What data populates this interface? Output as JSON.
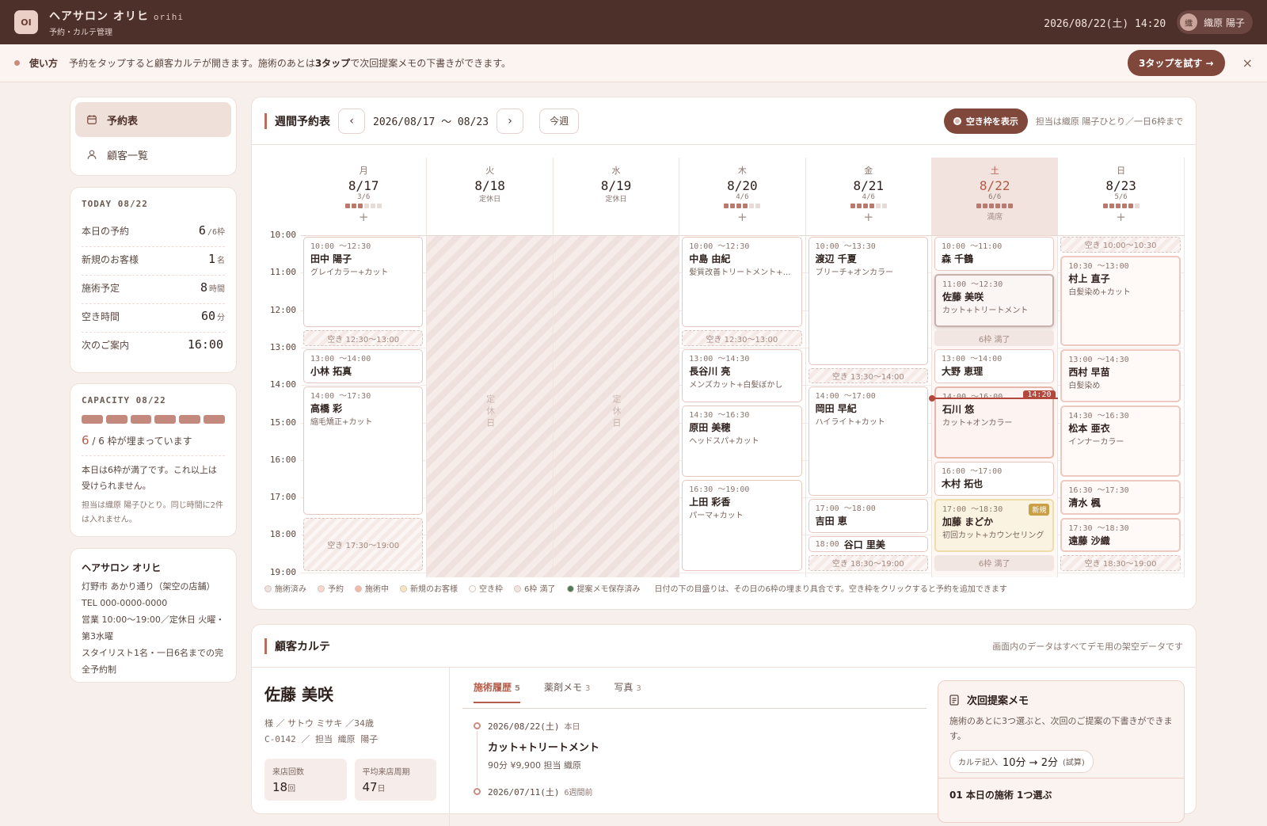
{
  "app": {
    "logo": "OI",
    "name": "ヘアサロン オリヒ",
    "name_en": "orihi",
    "sub": "予約・カルテ管理",
    "datetime": "2026/08/22(土) 14:20",
    "user_avatar": "織",
    "user_name": "織原 陽子"
  },
  "hint": {
    "title": "使い方",
    "text_a": "予約をタップすると顧客カルテが開きます。施術のあとは",
    "text_b": "3タップ",
    "text_c": "で次回提案メモの下書きができます。",
    "button": "3タップを試す →",
    "close": "×"
  },
  "nav": [
    {
      "label": "予約表",
      "icon": "calendar-icon"
    },
    {
      "label": "顧客一覧",
      "icon": "person-icon"
    }
  ],
  "today": {
    "title": "TODAY 08/22",
    "rows": [
      {
        "label": "本日の予約",
        "value": "6",
        "unit": "/6枠"
      },
      {
        "label": "新規のお客様",
        "value": "1",
        "unit": "名"
      },
      {
        "label": "施術予定",
        "value": "8",
        "unit": "時間"
      },
      {
        "label": "空き時間",
        "value": "60",
        "unit": "分"
      },
      {
        "label": "次のご案内",
        "value": "16:00",
        "unit": ""
      }
    ]
  },
  "capacity": {
    "title": "CAPACITY 08/22",
    "filled": 6,
    "total": 6,
    "count": "6",
    "count_text": "/ 6 枠が埋まっています",
    "msg": "本日は6枠が満了です。これ以上は受けられません。",
    "msg2": "担当は織原 陽子ひとり。同じ時間に2件は入れません。"
  },
  "shop": {
    "name": "ヘアサロン オリヒ",
    "lines": [
      "灯野市 あかり通り（架空の店舗）",
      "TEL 000-0000-0000",
      "営業 10:00〜19:00／定休日 火曜・第3水曜",
      "スタイリスト1名・一日6名までの完全予約制"
    ]
  },
  "schedule": {
    "title": "週間予約表",
    "range": "2026/08/17 〜 08/23",
    "this_week": "今週",
    "toggle": "空き枠を表示",
    "note": "担当は織原 陽子ひとり／一日6枠まで",
    "hours": [
      "10:00",
      "11:00",
      "12:00",
      "13:00",
      "14:00",
      "15:00",
      "16:00",
      "17:00",
      "18:00",
      "19:00"
    ],
    "closed_label": "定休日",
    "now": {
      "label": "14:20",
      "hour": 14.333
    },
    "days": [
      {
        "wd": "月",
        "date": "8/17",
        "cap": "3/6",
        "filled": 3,
        "closed": false,
        "plus": "+",
        "events": [
          {
            "kind": "plan",
            "s": 10,
            "e": 12.5,
            "tm": "10:00 〜12:30",
            "nm": "田中 陽子",
            "mn": "グレイカラー+カット"
          },
          {
            "kind": "free",
            "s": 12.5,
            "e": 13,
            "label": "空き 12:30〜13:00"
          },
          {
            "kind": "plan",
            "s": 13,
            "e": 14,
            "tm": "13:00 〜14:00",
            "nm": "小林 拓真",
            "mn": ""
          },
          {
            "kind": "plan",
            "s": 14,
            "e": 17.5,
            "tm": "14:00 〜17:30",
            "nm": "高橋 彩",
            "mn": "縮毛矯正+カット"
          },
          {
            "kind": "free",
            "s": 17.5,
            "e": 19,
            "label": "空き 17:30〜19:00"
          }
        ]
      },
      {
        "wd": "火",
        "date": "8/18",
        "cap": "定休日",
        "filled": -1,
        "closed": true,
        "plus": "",
        "events": []
      },
      {
        "wd": "水",
        "date": "8/19",
        "cap": "定休日",
        "filled": -1,
        "closed": true,
        "plus": "",
        "events": []
      },
      {
        "wd": "木",
        "date": "8/20",
        "cap": "4/6",
        "filled": 4,
        "closed": false,
        "plus": "+",
        "events": [
          {
            "kind": "plan",
            "s": 10,
            "e": 12.5,
            "tm": "10:00 〜12:30",
            "nm": "中島 由紀",
            "mn": "髪質改善トリートメント+カット"
          },
          {
            "kind": "free",
            "s": 12.5,
            "e": 13,
            "label": "空き 12:30〜13:00"
          },
          {
            "kind": "plan",
            "s": 13,
            "e": 14.5,
            "tm": "13:00 〜14:30",
            "nm": "長谷川 亮",
            "mn": "メンズカット+白髪ぼかし"
          },
          {
            "kind": "plan",
            "s": 14.5,
            "e": 16.5,
            "tm": "14:30 〜16:30",
            "nm": "原田 美穂",
            "mn": "ヘッドスパ+カット"
          },
          {
            "kind": "plan",
            "s": 16.5,
            "e": 19,
            "tm": "16:30 〜19:00",
            "nm": "上田 彩香",
            "mn": "パーマ+カット"
          }
        ]
      },
      {
        "wd": "金",
        "date": "8/21",
        "cap": "4/6",
        "filled": 4,
        "closed": false,
        "plus": "+",
        "events": [
          {
            "kind": "plan",
            "s": 10,
            "e": 13.5,
            "tm": "10:00 〜13:30",
            "nm": "渡辺 千夏",
            "mn": "ブリーチ+オンカラー"
          },
          {
            "kind": "free",
            "s": 13.5,
            "e": 14,
            "label": "空き 13:30〜14:00"
          },
          {
            "kind": "plan",
            "s": 14,
            "e": 17,
            "tm": "14:00 〜17:00",
            "nm": "岡田 早紀",
            "mn": "ハイライト+カット"
          },
          {
            "kind": "plan",
            "s": 17,
            "e": 18,
            "tm": "17:00 〜18:00",
            "nm": "吉田 恵",
            "mn": ""
          },
          {
            "kind": "short",
            "s": 18,
            "e": 18.5,
            "tm": "18:00",
            "nm": "谷口 里美",
            "mn": ""
          },
          {
            "kind": "free",
            "s": 18.5,
            "e": 19,
            "label": "空き 18:30〜19:00"
          }
        ]
      },
      {
        "wd": "土",
        "date": "8/22",
        "cap": "6/6",
        "filled": 6,
        "closed": false,
        "plus": "満席",
        "today": true,
        "events": [
          {
            "kind": "plan",
            "s": 10,
            "e": 11,
            "tm": "10:00 〜11:00",
            "nm": "森 千鶴",
            "mn": ""
          },
          {
            "kind": "sel",
            "s": 11,
            "e": 12.5,
            "tm": "11:00 〜12:30",
            "nm": "佐藤 美咲",
            "mn": "カット+トリートメント"
          },
          {
            "kind": "full",
            "s": 12.5,
            "e": 13,
            "label": "6枠 満了"
          },
          {
            "kind": "plan",
            "s": 13,
            "e": 14,
            "tm": "13:00 〜14:00",
            "nm": "大野 恵理",
            "mn": ""
          },
          {
            "kind": "inprog",
            "s": 14,
            "e": 16,
            "tm": "14:00 〜16:00",
            "nm": "石川 悠",
            "mn": "カット+オンカラー"
          },
          {
            "kind": "plan",
            "s": 16,
            "e": 17,
            "tm": "16:00 〜17:00",
            "nm": "木村 拓也",
            "mn": ""
          },
          {
            "kind": "newc",
            "s": 17,
            "e": 18.5,
            "tm": "17:00 〜18:30",
            "nm": "加藤 まどか",
            "mn": "初回カット+カウンセリング",
            "badge": "新規"
          },
          {
            "kind": "full",
            "s": 18.5,
            "e": 19,
            "label": "6枠 満了"
          }
        ]
      },
      {
        "wd": "日",
        "date": "8/23",
        "cap": "5/6",
        "filled": 5,
        "closed": false,
        "plus": "+",
        "events": [
          {
            "kind": "free",
            "s": 10,
            "e": 10.5,
            "label": "空き 10:00〜10:30"
          },
          {
            "kind": "pink",
            "s": 10.5,
            "e": 13,
            "tm": "10:30 〜13:00",
            "nm": "村上 直子",
            "mn": "白髪染め+カット"
          },
          {
            "kind": "pink",
            "s": 13,
            "e": 14.5,
            "tm": "13:00 〜14:30",
            "nm": "西村 早苗",
            "mn": "白髪染め"
          },
          {
            "kind": "pink",
            "s": 14.5,
            "e": 16.5,
            "tm": "14:30 〜16:30",
            "nm": "松本 亜衣",
            "mn": "インナーカラー"
          },
          {
            "kind": "pink",
            "s": 16.5,
            "e": 17.5,
            "tm": "16:30 〜17:30",
            "nm": "清水 楓",
            "mn": ""
          },
          {
            "kind": "pink",
            "s": 17.5,
            "e": 18.5,
            "tm": "17:30 〜18:30",
            "nm": "遠藤 沙織",
            "mn": ""
          },
          {
            "kind": "free",
            "s": 18.5,
            "e": 19,
            "label": "空き 18:30〜19:00"
          }
        ]
      }
    ],
    "legend": [
      {
        "label": "施術済み",
        "color": "#ece2de"
      },
      {
        "label": "予約",
        "color": "#f6d9d1"
      },
      {
        "label": "施術中",
        "color": "#f0b9a9"
      },
      {
        "label": "新規のお客様",
        "color": "#f5e6bd"
      },
      {
        "label": "空き枠",
        "color": "#ffffff"
      },
      {
        "label": "6枠 満了",
        "color": "#efe6e3"
      },
      {
        "label": "提案メモ保存済み",
        "color": "#4f7a58"
      }
    ],
    "legend_note": "日付の下の目盛りは、その日の6枠の埋まり具合です。空き枠をクリックすると予約を追加できます"
  },
  "karte": {
    "title": "顧客カルテ",
    "note": "画面内のデータはすべてデモ用の架空データです",
    "name": "佐藤 美咲",
    "sub1": "様 ／ サトウ ミサキ ／34歳",
    "sub2": "C-0142 ／ 担当 織原 陽子",
    "stats": [
      {
        "label": "来店回数",
        "value": "18",
        "unit": "回"
      },
      {
        "label": "平均来店周期",
        "value": "47",
        "unit": "日"
      }
    ],
    "tabs": [
      {
        "label": "施術履歴",
        "count": "5"
      },
      {
        "label": "薬剤メモ",
        "count": "3"
      },
      {
        "label": "写真",
        "count": "3"
      }
    ],
    "history": [
      {
        "date": "2026/08/22(土)",
        "tag": "本日",
        "title": "カット+トリートメント",
        "meta": "90分 ¥9,900 担当 織原"
      },
      {
        "date": "2026/07/11(土)",
        "tag": "6週間前",
        "title": "",
        "meta": ""
      }
    ],
    "memo": {
      "title": "次回提案メモ",
      "desc": "施術のあとに3つ選ぶと、次回のご提案の下書きができます。",
      "pill_label": "カルテ記入",
      "pill_value": "10分 → 2分",
      "pill_note": "(試算)",
      "next": "01 本日の施術 1つ選ぶ"
    }
  }
}
